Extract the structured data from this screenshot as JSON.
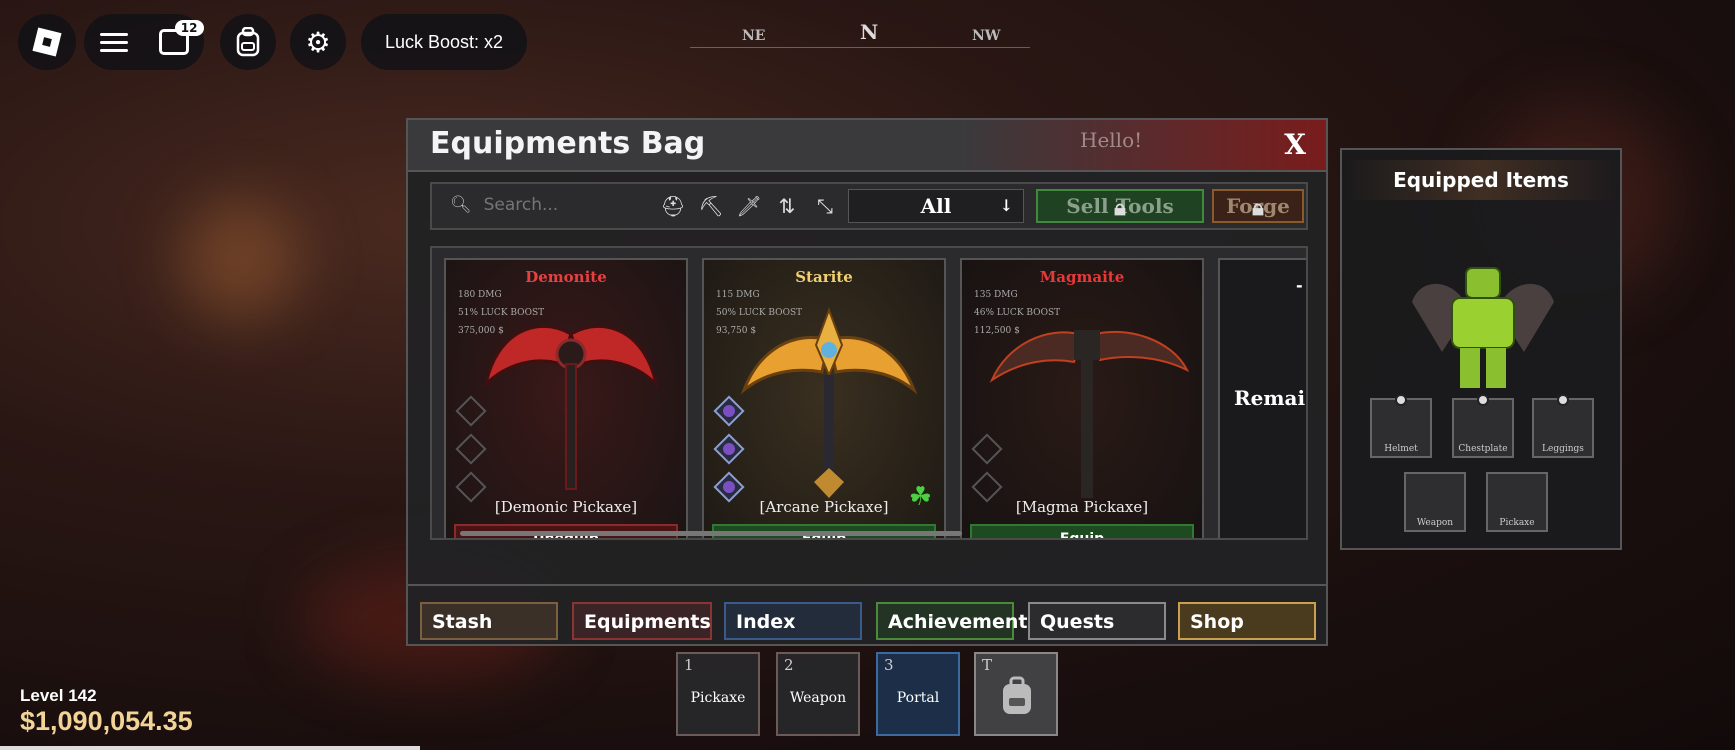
{
  "topbar": {
    "chat_badge": "12",
    "luck_boost": "Luck Boost: x2"
  },
  "compass": {
    "ne": "NE",
    "n": "N",
    "nw": "NW"
  },
  "bag": {
    "title": "Equipments Bag",
    "hello": "Hello!",
    "close": "X",
    "search_placeholder": "Search...",
    "filter": "All",
    "sell_tools": "Sell Tools",
    "forge": "Forge"
  },
  "items": [
    {
      "rarity": "Demonite",
      "rarity_color": "#e84040",
      "dmg": "180 DMG",
      "luck": "51% LUCK BOOST",
      "price": "375,000 $",
      "name": "[Demonic Pickaxe]",
      "action": "Unequip"
    },
    {
      "rarity": "Starite",
      "rarity_color": "#f0d070",
      "dmg": "115 DMG",
      "luck": "50% LUCK BOOST",
      "price": "93,750 $",
      "name": "[Arcane Pickaxe]",
      "action": "Equip"
    },
    {
      "rarity": "Magmaite",
      "rarity_color": "#e83838",
      "dmg": "135 DMG",
      "luck": "46% LUCK BOOST",
      "price": "112,500 $",
      "name": "[Magma Pickaxe]",
      "action": "Equip"
    },
    {
      "dash": "-",
      "partial": "Remai"
    }
  ],
  "tabs": [
    "Stash",
    "Equipments",
    "Index",
    "Achievements",
    "Quests",
    "Shop"
  ],
  "equipped": {
    "title": "Equipped Items",
    "slots": [
      "Helmet",
      "Chestplate",
      "Leggings",
      "Weapon",
      "Pickaxe"
    ]
  },
  "player": {
    "level": "Level 142",
    "money": "$1,090,054.35"
  },
  "hotbar": [
    {
      "key": "1",
      "label": "Pickaxe"
    },
    {
      "key": "2",
      "label": "Weapon"
    },
    {
      "key": "3",
      "label": "Portal"
    },
    {
      "key": "T",
      "label": ""
    }
  ]
}
